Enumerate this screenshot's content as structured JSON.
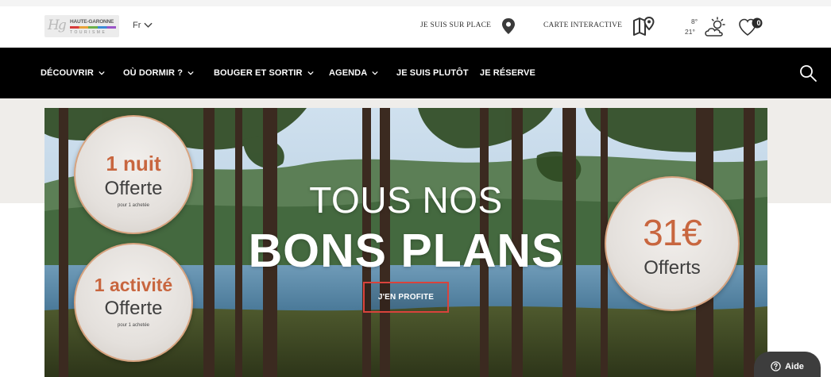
{
  "header": {
    "logo": {
      "monogram": "Hg",
      "line1": "HAUTE-GARONNE",
      "line2": "TOURISME"
    },
    "language": "Fr",
    "links": {
      "on_site": "JE SUIS SUR PLACE",
      "map": "CARTE INTERACTIVE"
    },
    "weather": {
      "temp_low": "8°",
      "temp_high": "21°",
      "icon": "sun-cloud-icon"
    },
    "favorites": {
      "count": "0",
      "icon": "heart-icon"
    }
  },
  "nav": {
    "items": [
      {
        "label": "DÉCOUVRIR",
        "has_dropdown": true
      },
      {
        "label": "OÙ DORMIR ?",
        "has_dropdown": true
      },
      {
        "label": "BOUGER ET SORTIR",
        "has_dropdown": true
      },
      {
        "label": "AGENDA",
        "has_dropdown": true
      },
      {
        "label": "JE SUIS PLUTÔT",
        "has_dropdown": false
      },
      {
        "label": "JE RÉSERVE",
        "has_dropdown": false
      }
    ],
    "search_icon": "search-icon"
  },
  "hero": {
    "title_line1": "TOUS NOS",
    "title_line2": "BONS PLANS",
    "cta": "J'EN PROFITE",
    "offers": [
      {
        "big": "1 nuit",
        "mid": "Offerte",
        "small": "pour 1 achetée"
      },
      {
        "big": "1 activité",
        "mid": "Offerte",
        "small": "pour 1 achetée"
      },
      {
        "big": "31€",
        "mid": "Offerts"
      }
    ]
  },
  "help": {
    "label": "Aide"
  },
  "colors": {
    "accent": "#d9433c",
    "offer_orange": "#c8663f",
    "nav_bg": "#000000"
  }
}
